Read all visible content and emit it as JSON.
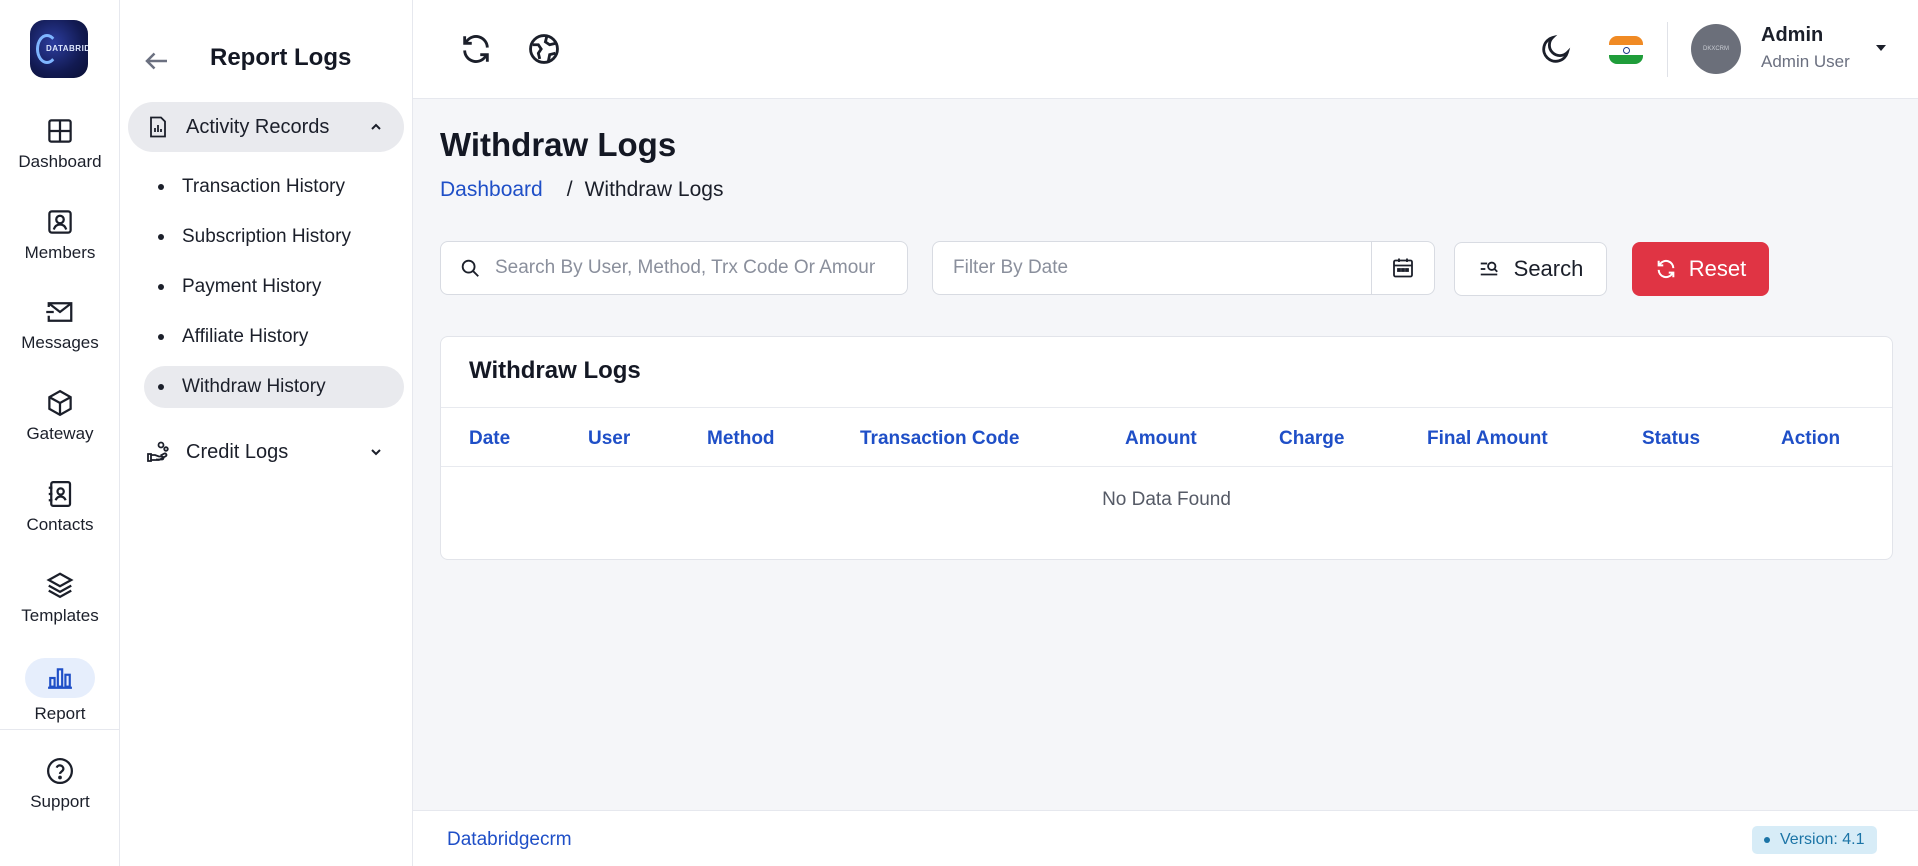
{
  "logo": {
    "text": "DATABRIDGE"
  },
  "rail": {
    "items": [
      {
        "label": "Dashboard",
        "icon": "dashboard-grid-icon"
      },
      {
        "label": "Members",
        "icon": "members-icon"
      },
      {
        "label": "Messages",
        "icon": "messages-icon"
      },
      {
        "label": "Gateway",
        "icon": "gateway-cube-icon"
      },
      {
        "label": "Contacts",
        "icon": "contacts-icon"
      },
      {
        "label": "Templates",
        "icon": "templates-layers-icon"
      },
      {
        "label": "Report",
        "icon": "report-chart-icon"
      },
      {
        "label": "Support",
        "icon": "support-question-icon"
      }
    ],
    "active": "Report"
  },
  "sidebar": {
    "title": "Report Logs",
    "groups": [
      {
        "label": "Activity Records",
        "expanded": true,
        "items": [
          {
            "label": "Transaction History"
          },
          {
            "label": "Subscription History"
          },
          {
            "label": "Payment History"
          },
          {
            "label": "Affiliate History"
          },
          {
            "label": "Withdraw History",
            "active": true
          }
        ]
      },
      {
        "label": "Credit Logs",
        "expanded": false
      }
    ]
  },
  "topbar": {
    "user": {
      "name": "Admin",
      "role": "Admin User",
      "avatar_text": "DKXCRM"
    }
  },
  "main": {
    "title": "Withdraw Logs",
    "breadcrumb": {
      "home": "Dashboard",
      "separator": "/",
      "current": "Withdraw Logs"
    },
    "filters": {
      "search_placeholder": "Search By User, Method, Trx Code Or Amount",
      "date_placeholder": "Filter By Date",
      "search_label": "Search",
      "reset_label": "Reset"
    },
    "table": {
      "title": "Withdraw Logs",
      "columns": [
        "Date",
        "User",
        "Method",
        "Transaction Code",
        "Amount",
        "Charge",
        "Final Amount",
        "Status",
        "Action"
      ],
      "empty_text": "No Data Found"
    }
  },
  "footer": {
    "brand": "Databridgecrm",
    "version": "Version: 4.1"
  },
  "colors": {
    "accent": "#1f4fc7",
    "danger": "#e03444",
    "active_bg": "#e9eaee"
  }
}
